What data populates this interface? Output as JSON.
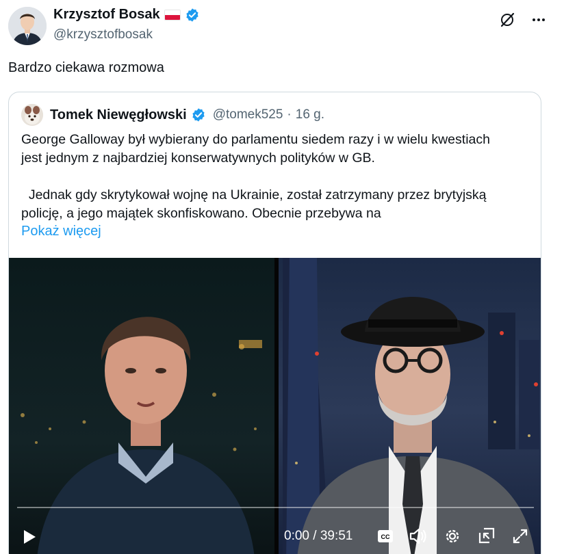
{
  "author": {
    "display_name": "Krzysztof Bosak",
    "handle": "@krzysztofbosak",
    "flag_icon": "poland-flag-icon",
    "verified_icon": "verified-badge-icon"
  },
  "toolbar": {
    "grok_icon": "grok-icon",
    "more_icon": "more-icon"
  },
  "tweet": {
    "text": "Bardzo ciekawa rozmowa"
  },
  "quote": {
    "display_name": "Tomek Niewęgłowski",
    "handle": "@tomek525",
    "separator": "·",
    "time": "16 g.",
    "lines": [
      "George Galloway był wybierany do parlamentu siedem razy i w wielu kwestiach",
      "jest jednym z najbardziej konserwatywnych polityków w GB.",
      "  Jednak gdy skrytykował wojnę na Ukrainie, został zatrzymany przez brytyjską",
      "policję, a jego majątek skonfiskowano. Obecnie przebywa na"
    ],
    "show_more": "Pokaż więcej"
  },
  "video": {
    "time": "0:00 / 39:51",
    "progress": 0,
    "controls": [
      "play-icon",
      "captions-icon",
      "volume-icon",
      "settings-icon",
      "pip-icon",
      "fullscreen-icon"
    ],
    "colors": {
      "accent": "#1d9bf0",
      "link": "#1d9bf0",
      "muted": "#536471"
    }
  }
}
